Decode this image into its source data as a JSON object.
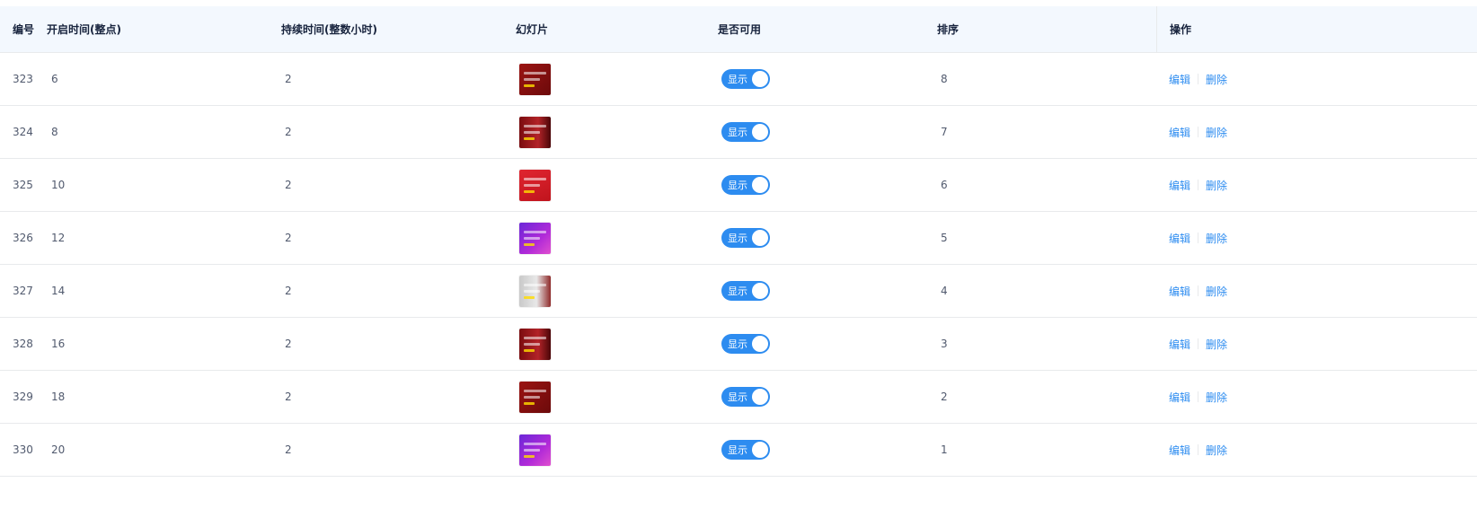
{
  "header": {
    "id": "编号",
    "start": "开启时间(整点)",
    "duration": "持续时间(整数小时)",
    "slide": "幻灯片",
    "enabled": "是否可用",
    "sort": "排序",
    "ops": "操作"
  },
  "rows": [
    {
      "id": "323",
      "start": "6",
      "duration": "2",
      "thumb": "t-red",
      "status": "显示",
      "sort": "8",
      "edit": "编辑",
      "delete": "删除"
    },
    {
      "id": "324",
      "start": "8",
      "duration": "2",
      "thumb": "t-redphone",
      "status": "显示",
      "sort": "7",
      "edit": "编辑",
      "delete": "删除"
    },
    {
      "id": "325",
      "start": "10",
      "duration": "2",
      "thumb": "t-brightred",
      "status": "显示",
      "sort": "6",
      "edit": "编辑",
      "delete": "删除"
    },
    {
      "id": "326",
      "start": "12",
      "duration": "2",
      "thumb": "t-purple",
      "status": "显示",
      "sort": "5",
      "edit": "编辑",
      "delete": "删除"
    },
    {
      "id": "327",
      "start": "14",
      "duration": "2",
      "thumb": "t-gray",
      "status": "显示",
      "sort": "4",
      "edit": "编辑",
      "delete": "删除"
    },
    {
      "id": "328",
      "start": "16",
      "duration": "2",
      "thumb": "t-redphone",
      "status": "显示",
      "sort": "3",
      "edit": "编辑",
      "delete": "删除"
    },
    {
      "id": "329",
      "start": "18",
      "duration": "2",
      "thumb": "t-red",
      "status": "显示",
      "sort": "2",
      "edit": "编辑",
      "delete": "删除"
    },
    {
      "id": "330",
      "start": "20",
      "duration": "2",
      "thumb": "t-purple",
      "status": "显示",
      "sort": "1",
      "edit": "编辑",
      "delete": "删除"
    }
  ],
  "colors": {
    "accent": "#2d8cf0",
    "header_bg": "#f3f8fe",
    "border": "#e8eaec"
  }
}
